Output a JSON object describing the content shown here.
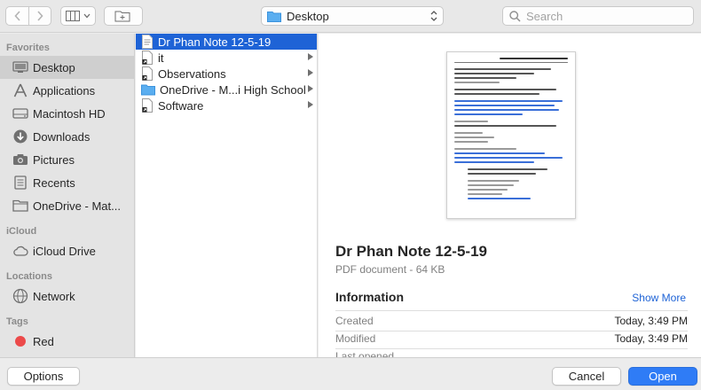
{
  "toolbar": {
    "location": "Desktop",
    "search_placeholder": "Search"
  },
  "sidebar": {
    "favorites_label": "Favorites",
    "favorites": [
      {
        "label": "Desktop",
        "icon": "desktop-icon",
        "selected": true
      },
      {
        "label": "Applications",
        "icon": "applications-icon"
      },
      {
        "label": "Macintosh HD",
        "icon": "hard-drive-icon"
      },
      {
        "label": "Downloads",
        "icon": "downloads-icon"
      },
      {
        "label": "Pictures",
        "icon": "pictures-icon"
      },
      {
        "label": "Recents",
        "icon": "recents-icon"
      },
      {
        "label": "OneDrive - Mat...",
        "icon": "folder-icon"
      }
    ],
    "icloud_label": "iCloud",
    "icloud": [
      {
        "label": "iCloud Drive",
        "icon": "cloud-icon"
      }
    ],
    "locations_label": "Locations",
    "locations": [
      {
        "label": "Network",
        "icon": "network-icon"
      }
    ],
    "tags_label": "Tags",
    "tags": [
      {
        "label": "Red",
        "icon": "red-tag-icon",
        "color": "#ec4a4a"
      }
    ]
  },
  "files": [
    {
      "name": "Dr Phan Note 12-5-19",
      "icon": "pdf-file-icon",
      "selected": true
    },
    {
      "name": "it",
      "icon": "alias-icon",
      "has_children": true
    },
    {
      "name": "Observations",
      "icon": "alias-icon",
      "has_children": true
    },
    {
      "name": "OneDrive - M...i High School",
      "icon": "folder-icon",
      "has_children": true
    },
    {
      "name": "Software",
      "icon": "alias-icon",
      "has_children": true
    }
  ],
  "preview": {
    "title": "Dr Phan Note 12-5-19",
    "subtitle": "PDF document - 64 KB",
    "info_heading": "Information",
    "show_more": "Show More",
    "info": [
      {
        "key": "Created",
        "value": "Today, 3:49 PM"
      },
      {
        "key": "Modified",
        "value": "Today, 3:49 PM"
      },
      {
        "key": "Last opened",
        "value": ""
      }
    ]
  },
  "buttons": {
    "options": "Options",
    "cancel": "Cancel",
    "open": "Open"
  },
  "colors": {
    "accent": "#1e63d6",
    "primary_button": "#2f7cf6"
  }
}
